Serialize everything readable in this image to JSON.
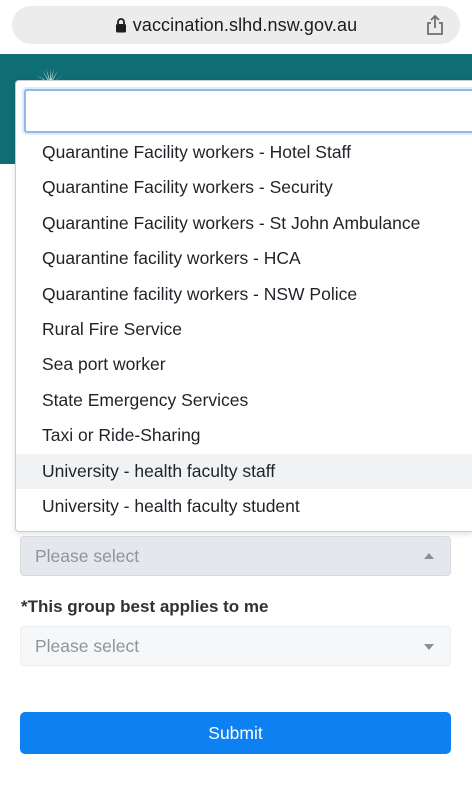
{
  "browser": {
    "url": "vaccination.slhd.nsw.gov.au"
  },
  "dropdown": {
    "search_value": "",
    "options": [
      "Quarantine Facility workers - Hotel Staff",
      "Quarantine Facility workers - Security",
      "Quarantine Facility workers - St John Ambulance",
      "Quarantine facility workers - HCA",
      "Quarantine facility workers - NSW Police",
      "Rural Fire Service",
      "Sea port worker",
      "State Emergency Services",
      "Taxi or Ride-Sharing",
      "University - health faculty staff",
      "University - health faculty student"
    ]
  },
  "form": {
    "category_select": {
      "value": "Please select"
    },
    "group_label": "*This group best applies to me",
    "group_select": {
      "value": "Please select"
    },
    "submit_label": "Submit"
  },
  "colors": {
    "header": "#0e6e74",
    "submit": "#0d80f2",
    "focus_border": "#8fb9ea"
  }
}
